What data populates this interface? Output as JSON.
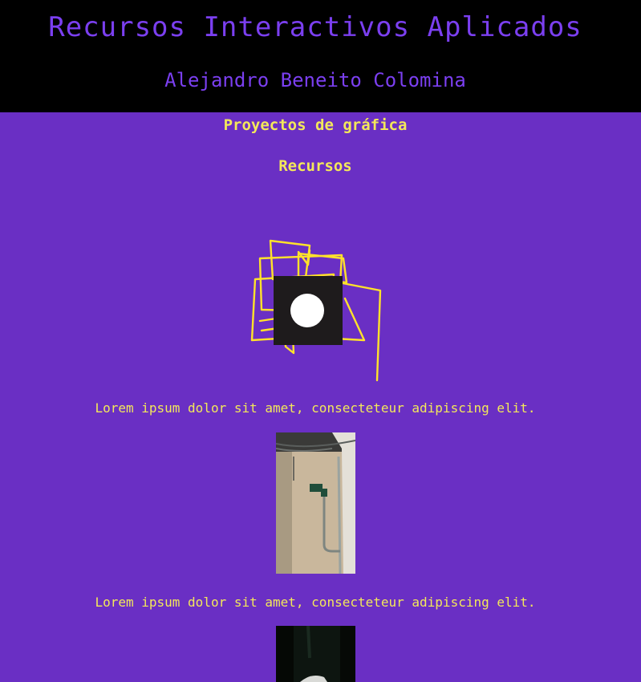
{
  "header": {
    "title": "Recursos Interactivos Aplicados",
    "author": "Alejandro Beneito Colomina"
  },
  "main": {
    "section_title": "Proyectos de gráfica",
    "subsection_title": "Recursos",
    "captions": [
      "Lorem ipsum dolor sit amet, consecteteur adipiscing elit.",
      "Lorem ipsum dolor sit amet, consecteteur adipiscing elit."
    ]
  },
  "colors": {
    "background": "#6a2fc4",
    "header_background": "#000000",
    "header_text": "#7b3ff0",
    "accent_text": "#f3e85a"
  }
}
